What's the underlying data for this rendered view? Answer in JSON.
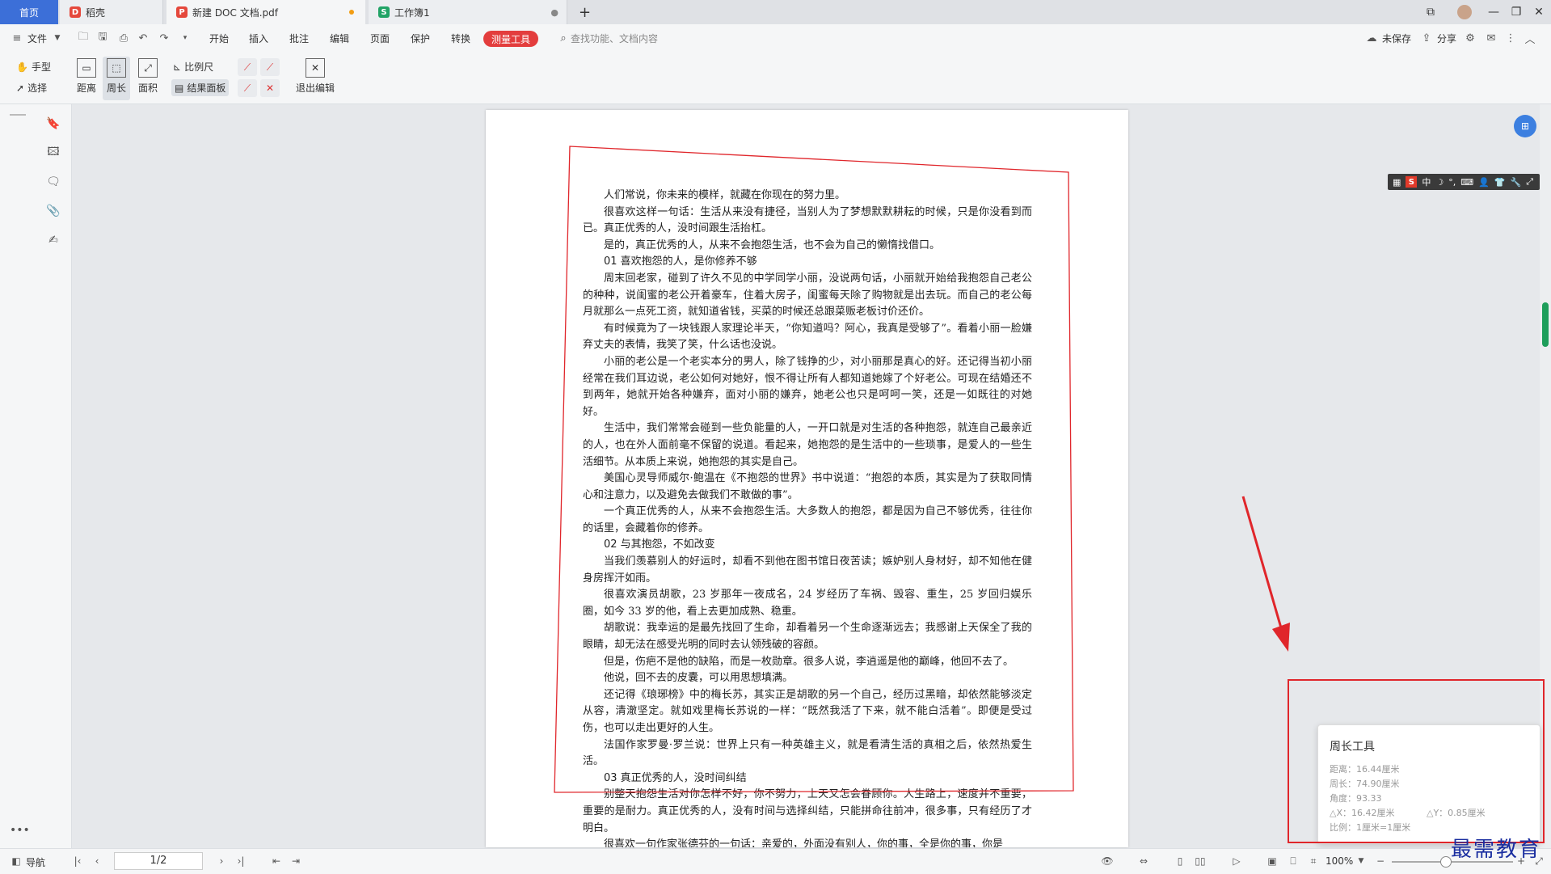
{
  "tabs": {
    "home": "首页",
    "daoke": "稻壳",
    "doc": "新建 DOC 文档.pdf",
    "sheet": "工作簿1",
    "new_tab": "+"
  },
  "menu": {
    "file": "文件",
    "items": [
      "开始",
      "插入",
      "批注",
      "编辑",
      "页面",
      "保护",
      "转换"
    ],
    "measure": "测量工具",
    "search_placeholder": "查找功能、文档内容",
    "unsaved": "未保存",
    "share": "分享"
  },
  "toolbar": {
    "hand": "手型",
    "select": "选择",
    "distance": "距离",
    "perimeter": "周长",
    "area": "面积",
    "scale": "比例尺",
    "result_panel": "结果面板",
    "exit_edit": "退出编辑"
  },
  "document": {
    "paragraphs": [
      {
        "text": "人们常说，你未来的模样，就藏在你现在的努力里。",
        "head": false
      },
      {
        "text": "很喜欢这样一句话：生活从来没有捷径，当别人为了梦想默默耕耘的时候，只是你没看到而已。真正优秀的人，没时间跟生活抬杠。",
        "head": false
      },
      {
        "text": "是的，真正优秀的人，从来不会抱怨生活，也不会为自己的懒惰找借口。",
        "head": false
      },
      {
        "text": "01 喜欢抱怨的人，是你修养不够",
        "head": true
      },
      {
        "text": "周末回老家，碰到了许久不见的中学同学小丽，没说两句话，小丽就开始给我抱怨自己老公的种种，说闺蜜的老公开着豪车，住着大房子，闺蜜每天除了购物就是出去玩。而自己的老公每月就那么一点死工资，就知道省钱，买菜的时候还总跟菜贩老板讨价还价。",
        "head": false
      },
      {
        "text": "有时候竟为了一块钱跟人家理论半天，“你知道吗？阿心，我真是受够了”。看着小丽一脸嫌弃丈夫的表情，我笑了笑，什么话也没说。",
        "head": false
      },
      {
        "text": "小丽的老公是一个老实本分的男人，除了钱挣的少，对小丽那是真心的好。还记得当初小丽经常在我们耳边说，老公如何对她好，恨不得让所有人都知道她嫁了个好老公。可现在结婚还不到两年，她就开始各种嫌弃，面对小丽的嫌弃，她老公也只是呵呵一笑，还是一如既往的对她好。",
        "head": false
      },
      {
        "text": "生活中，我们常常会碰到一些负能量的人，一开口就是对生活的各种抱怨，就连自己最亲近的人，也在外人面前毫不保留的说道。看起来，她抱怨的是生活中的一些琐事，是爱人的一些生活细节。从本质上来说，她抱怨的其实是自己。",
        "head": false
      },
      {
        "text": "美国心灵导师威尔·鲍温在《不抱怨的世界》书中说道：“抱怨的本质，其实是为了获取同情心和注意力，以及避免去做我们不敢做的事”。",
        "head": false
      },
      {
        "text": "一个真正优秀的人，从来不会抱怨生活。大多数人的抱怨，都是因为自己不够优秀，往往你的话里，会藏着你的修养。",
        "head": false
      },
      {
        "text": "02 与其抱怨，不如改变",
        "head": true
      },
      {
        "text": "当我们羡慕别人的好运时，却看不到他在图书馆日夜苦读；嫉妒别人身材好，却不知他在健身房挥汗如雨。",
        "head": false
      },
      {
        "text": "很喜欢演员胡歌，23 岁那年一夜成名，24 岁经历了车祸、毁容、重生，25 岁回归娱乐圈，如今 33 岁的他，看上去更加成熟、稳重。",
        "head": false
      },
      {
        "text": "胡歌说：我幸运的是最先找回了生命，却看着另一个生命逐渐远去；我感谢上天保全了我的眼睛，却无法在感受光明的同时去认领残破的容颜。",
        "head": false
      },
      {
        "text": "但是，伤疤不是他的缺陷，而是一枚勋章。很多人说，李逍遥是他的巅峰，他回不去了。",
        "head": false
      },
      {
        "text": "他说，回不去的皮囊，可以用思想填满。",
        "head": false
      },
      {
        "text": "还记得《琅琊榜》中的梅长苏，其实正是胡歌的另一个自己，经历过黑暗，却依然能够淡定从容，清澈坚定。就如戏里梅长苏说的一样：“既然我活了下来，就不能白活着”。即便是受过伤，也可以走出更好的人生。",
        "head": false
      },
      {
        "text": "法国作家罗曼·罗兰说：世界上只有一种英雄主义，就是看清生活的真相之后，依然热爱生活。",
        "head": false
      },
      {
        "text": "03 真正优秀的人，没时间纠结",
        "head": true
      },
      {
        "text": "别整天抱怨生活对你怎样不好，你不努力，上天又怎会眷顾你。人生路上，速度并不重要，重要的是耐力。真正优秀的人，没有时间与选择纠结，只能拼命往前冲，很多事，只有经历了才明白。",
        "head": false
      },
      {
        "text": "很喜欢一句作家张德芬的一句话：亲爱的，外面没有别人，你的事，全是你的事，你是",
        "head": false
      }
    ]
  },
  "result_panel": {
    "title": "周长工具",
    "distance": "距离：16.44厘米",
    "perimeter": "周长：74.90厘米",
    "angle": "角度：93.33",
    "dx": "△X：16.42厘米",
    "dy": "△Y：0.85厘米",
    "scale": "比例：1厘米=1厘米"
  },
  "ime": {
    "lang": "中"
  },
  "statusbar": {
    "nav": "导航",
    "page": "1/2",
    "zoom": "100%"
  },
  "watermark": "最需教育",
  "colors": {
    "accent_blue": "#3c6fd8",
    "measure_red": "#e33d3d",
    "annotation_red": "#e0262b",
    "scroll_green": "#1f9e5b"
  }
}
